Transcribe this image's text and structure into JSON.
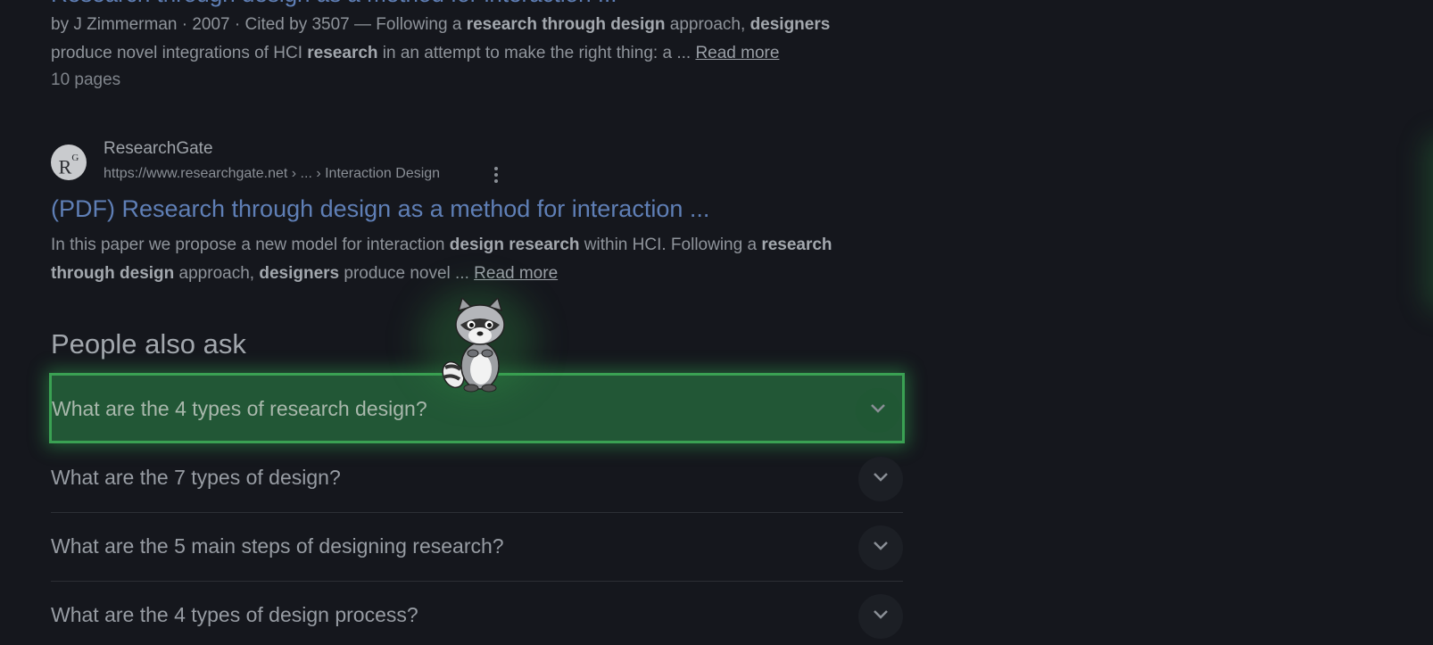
{
  "result_1": {
    "title": "Research through design as a method for interaction ...",
    "byline": "by J Zimmerman · 2007 · Cited by 3507 —",
    "snippet_line1": [
      {
        "text": " Following a ",
        "bold": false
      },
      {
        "text": "research through design",
        "bold": true
      },
      {
        "text": " approach, ",
        "bold": false
      },
      {
        "text": "designers",
        "bold": true
      }
    ],
    "snippet_line2": [
      {
        "text": "produce novel integrations of HCI ",
        "bold": false
      },
      {
        "text": "research",
        "bold": true
      },
      {
        "text": " in an attempt to make the right thing: a ... ",
        "bold": false
      }
    ],
    "read_more": "Read more",
    "pages": "10 pages"
  },
  "result_2": {
    "favicon_text": "R",
    "favicon_sup": "G",
    "site_name": "ResearchGate",
    "url": "https://www.researchgate.net › ... › Interaction Design",
    "title": "(PDF) Research through design as a method for interaction ...",
    "snippet_line1": [
      {
        "text": "In this paper we propose a new model for interaction ",
        "bold": false
      },
      {
        "text": "design research",
        "bold": true
      },
      {
        "text": " within HCI. Following a ",
        "bold": false
      },
      {
        "text": "research",
        "bold": true
      }
    ],
    "snippet_line2": [
      {
        "text": "through design",
        "bold": true
      },
      {
        "text": " approach, ",
        "bold": false
      },
      {
        "text": "designers",
        "bold": true
      },
      {
        "text": " produce novel ... ",
        "bold": false
      }
    ],
    "read_more": "Read more"
  },
  "people_also_ask": {
    "heading": "People also ask",
    "questions": [
      {
        "text": "What are the 4 types of research design?",
        "highlighted": true
      },
      {
        "text": "What are the 7 types of design?",
        "highlighted": false
      },
      {
        "text": "What are the 5 main steps of designing research?",
        "highlighted": false
      },
      {
        "text": "What are the 4 types of design process?",
        "highlighted": false
      }
    ]
  },
  "icons": {
    "chevron": "chevron-down-icon",
    "more": "more-vert-icon",
    "mascot": "raccoon-mascot"
  },
  "colors": {
    "background": "#15171d",
    "link": "#5f7fb6",
    "highlight_fill": "#2e8c4a",
    "highlight_border": "#3aa153"
  }
}
